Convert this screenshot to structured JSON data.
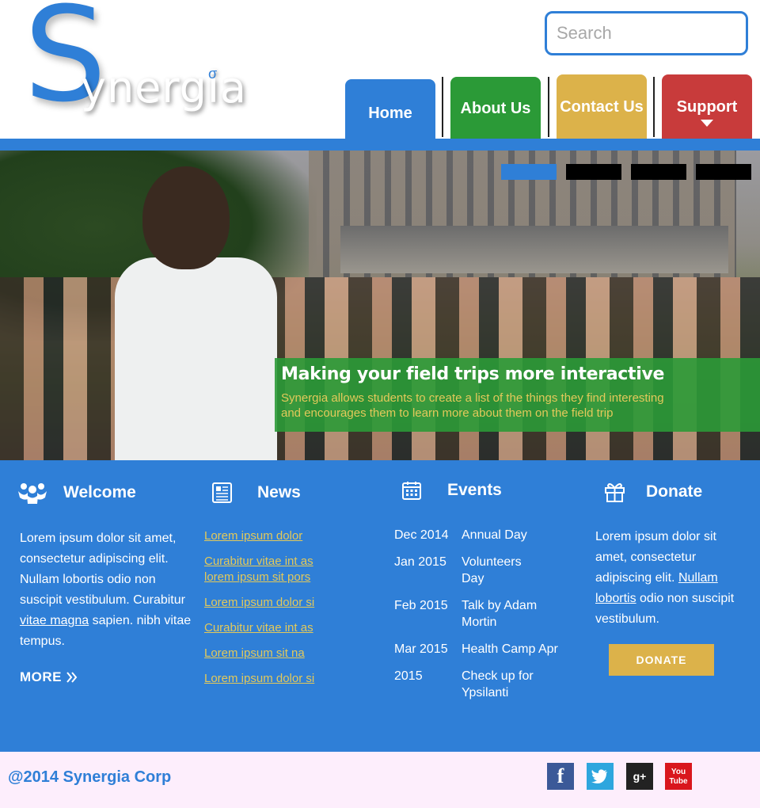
{
  "brand": {
    "logo_initial": "S",
    "logo_rest": "ynergia",
    "logo_mark": "σ"
  },
  "search": {
    "placeholder": "Search"
  },
  "nav": {
    "home": "Home",
    "about": "About Us",
    "contact": "Contact Us",
    "support": "Support"
  },
  "hero": {
    "title": "Making your field trips more interactive",
    "description_line1": "Synergia allows students to create a list of the things they find interesting",
    "description_line2": "and encourages them to learn more about them on the field trip",
    "slides": 4,
    "active_slide": 1
  },
  "welcome": {
    "title": "Welcome",
    "text_before": "Lorem ipsum dolor sit amet, consectetur adipiscing elit. Nullam lobortis odio non suscipit vestibulum. Curabitur ",
    "link": "vitae magna",
    "text_after": " sapien. nibh vitae tempus.",
    "more": "MORE"
  },
  "news": {
    "title": "News",
    "items": [
      "Lorem ipsum dolor ",
      "Curabitur vitae int as lorem ipsum sit pors",
      "Lorem ipsum dolor si ",
      "Curabitur vitae int as ",
      "Lorem ipsum sit na ",
      "Lorem ipsum dolor si "
    ]
  },
  "events": {
    "title": "Events",
    "items": [
      {
        "date": "Dec 2014",
        "name": "Annual Day"
      },
      {
        "date": "Jan 2015",
        "name": "Volunteers Day"
      },
      {
        "date": "Feb 2015",
        "name": "Talk by Adam Mortin"
      },
      {
        "date": "Mar 2015",
        "name": "Health Camp Apr"
      },
      {
        "date": "2015",
        "name": "Check up for Ypsilanti"
      }
    ]
  },
  "donate": {
    "title": "Donate",
    "text_before": "Lorem ipsum dolor sit amet, consectetur adipiscing elit. ",
    "link": "Nullam lobortis",
    "text_after": " odio non suscipit vestibulum.",
    "button": "DONATE"
  },
  "footer": {
    "copyright": "@2014 Synergia Corp",
    "social": {
      "facebook": "f",
      "google_plus": "g+",
      "youtube_line1": "You",
      "youtube_line2": "Tube"
    }
  },
  "colors": {
    "primary_blue": "#2f7fd7",
    "green": "#2b9a37",
    "gold": "#dcb24a",
    "red": "#c83b3b",
    "footer_bg": "#fdeefc"
  }
}
